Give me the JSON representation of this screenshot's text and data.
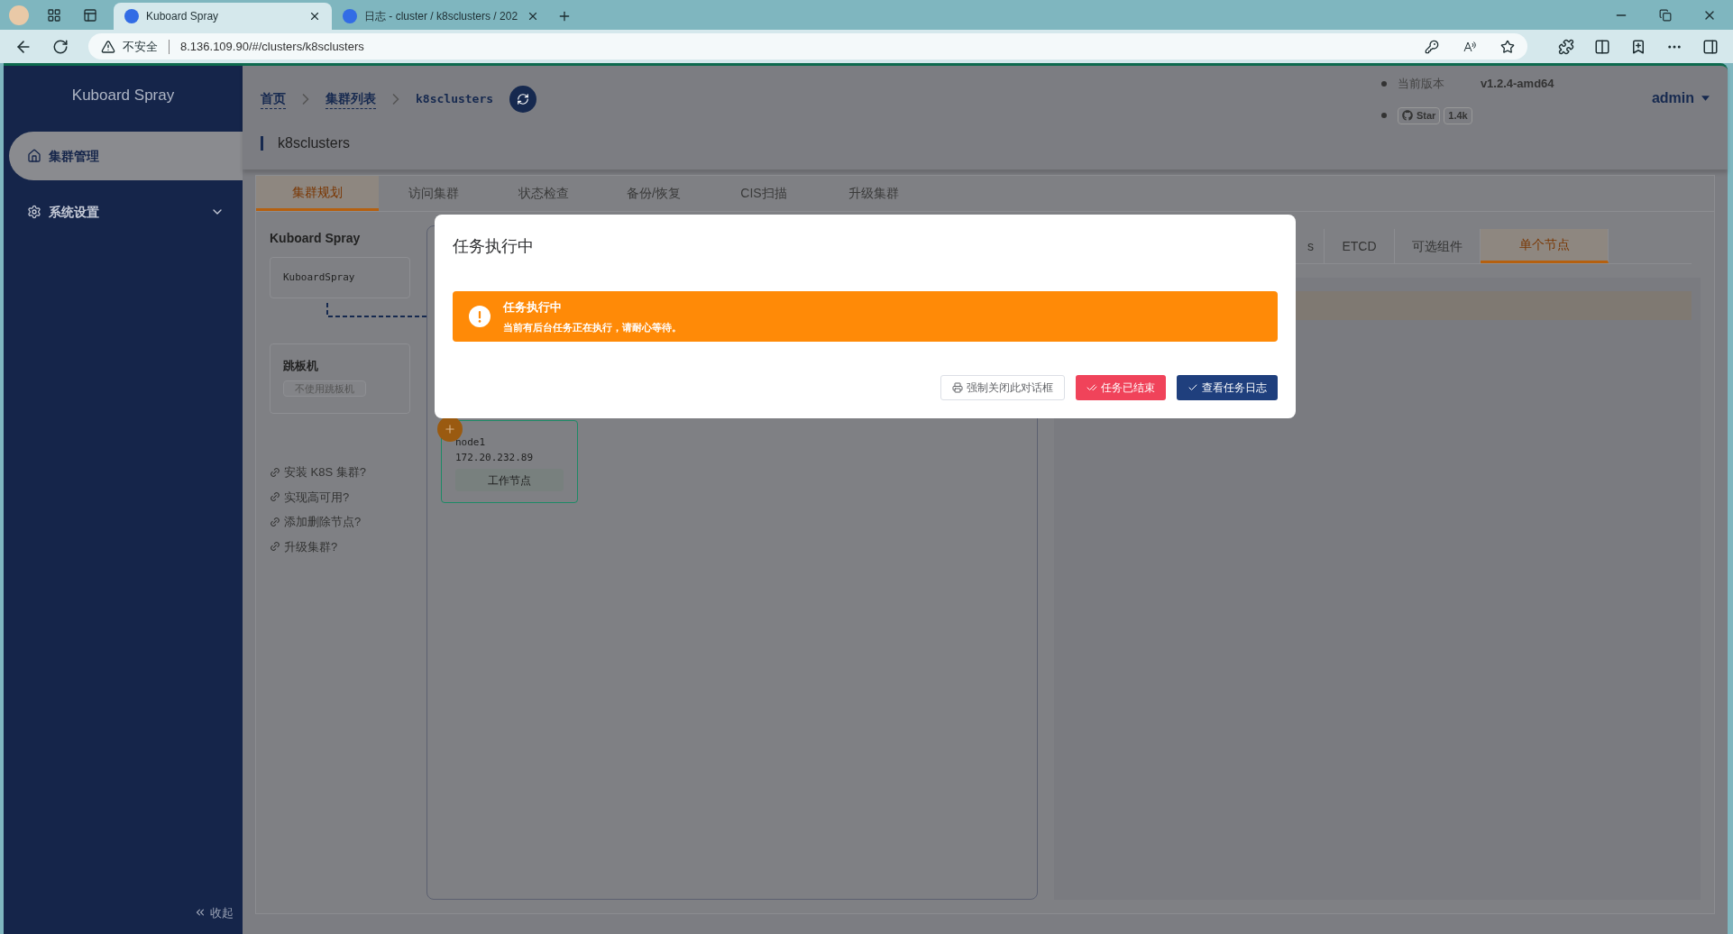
{
  "browser": {
    "tabs": [
      {
        "title": "Kuboard Spray",
        "selected": true
      },
      {
        "title": "日志 - cluster / k8sclusters / 202",
        "selected": false
      }
    ],
    "security_label": "不安全",
    "url": "8.136.109.90/#/clusters/k8sclusters"
  },
  "sidebar": {
    "brand": "Kuboard Spray",
    "items": [
      {
        "label": "集群管理",
        "selected": true,
        "expandable": false
      },
      {
        "label": "系统设置",
        "selected": false,
        "expandable": true
      }
    ],
    "collapse": "收起"
  },
  "breadcrumb": [
    "首页",
    "集群列表",
    "k8sclusters"
  ],
  "header": {
    "version_label": "当前版本",
    "version": "v1.2.4-amd64",
    "star_label": "Star",
    "star_count": "1.4k",
    "user": "admin"
  },
  "page_title": "k8sclusters",
  "tabs": [
    {
      "label": "集群规划",
      "selected": true
    },
    {
      "label": "访问集群",
      "selected": false
    },
    {
      "label": "状态检查",
      "selected": false
    },
    {
      "label": "备份/恢复",
      "selected": false
    },
    {
      "label": "CIS扫描",
      "selected": false
    },
    {
      "label": "升级集群",
      "selected": false
    }
  ],
  "left": {
    "heading": "Kuboard Spray",
    "spray_card": "KuboardSpray",
    "bastion": {
      "title": "跳板机",
      "tag": "不使用跳板机"
    },
    "links": [
      "安装 K8S 集群?",
      "实现高可用?",
      "添加删除节点?",
      "升级集群?"
    ]
  },
  "nodes": [
    {
      "name": "node1",
      "ip": "172.20.232.89",
      "role": "工作节点"
    }
  ],
  "detail_tabs": [
    {
      "label": "s",
      "selected": false
    },
    {
      "label": "ETCD",
      "selected": false
    },
    {
      "label": "可选组件",
      "selected": false
    },
    {
      "label": "单个节点",
      "selected": true
    }
  ],
  "dialog": {
    "title": "任务执行中",
    "alert": {
      "title": "任务执行中",
      "message": "当前有后台任务正在执行，请耐心等待。"
    },
    "buttons": [
      {
        "label": "强制关闭此对话框",
        "kind": "default"
      },
      {
        "label": "任务已结束",
        "kind": "danger"
      },
      {
        "label": "查看任务日志",
        "kind": "primary"
      }
    ]
  }
}
